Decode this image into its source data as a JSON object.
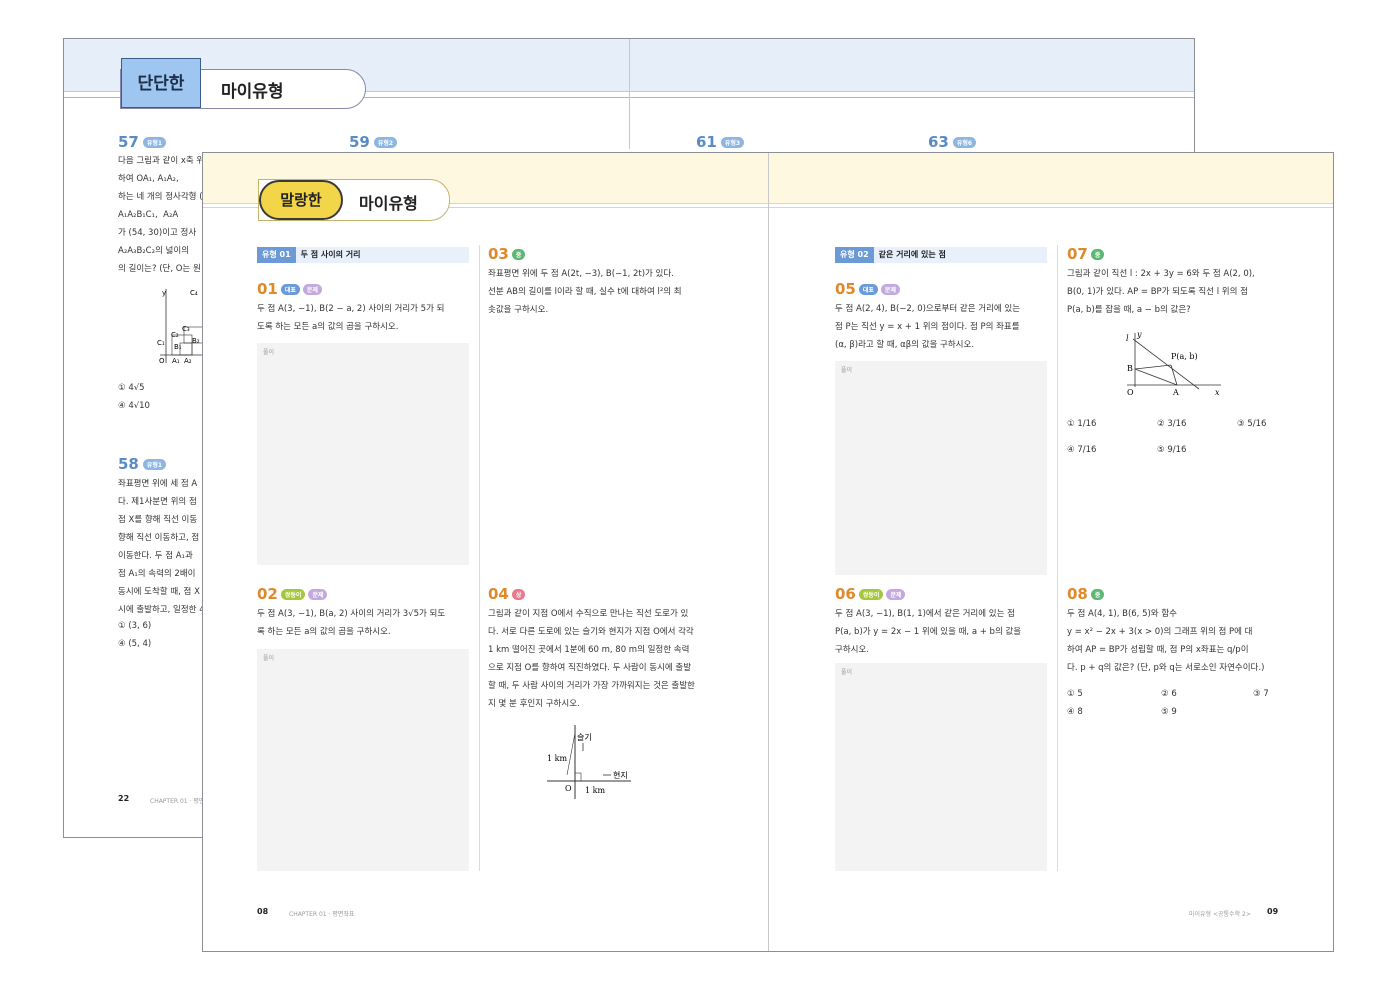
{
  "back_page": {
    "badge_left": "단단한",
    "badge_right": "마이유형",
    "questions": [
      {
        "num": "57",
        "tag": "유형1"
      },
      {
        "num": "59",
        "tag": "유형2"
      },
      {
        "num": "61",
        "tag": "유형3"
      },
      {
        "num": "63",
        "tag": "유형6"
      },
      {
        "num": "58",
        "tag": "유형1"
      }
    ],
    "q57_text": "다음 그림과 같이 x축 위\n하여 OA₁, A₁A₂, \n하는 네 개의 정사각형 (\nA₁A₂B₁C₁,  A₂A\n가 (54, 30)이고 정사\nA₂A₃B₂C₂의 넓이의\n의 길이는? (단, O는 원",
    "q57_choice1": "① 4√5",
    "q57_choice2": "④ 4√10",
    "q58_text": "좌표평면 위에 세 점 A\n다. 제1사분면 위의 점\n점 X를 향해 직선 이동\n향해 직선 이동하고, 점\n이동한다. 두 점 A₁과\n점 A₁의 속력의 2배이\n동시에 도착할 때, 점 X\n시에 출발하고, 일정한 4",
    "q58_choice1": "① (3, 6)",
    "q58_choice2": "④ (5, 4)",
    "fig_labels": {
      "y": "y",
      "c4": "C₄",
      "c3": "C₃",
      "c2": "C₂",
      "c1": "C₁",
      "b1": "B₁",
      "b2": "B₂",
      "o": "O",
      "a1": "A₁",
      "a2": "A₂"
    },
    "page_num": "22",
    "chapter": "CHAPTER 01 · 평면"
  },
  "front_left": {
    "badge_left": "말랑한",
    "badge_right": "마이유형",
    "type_label": "유형 01",
    "type_title": "두 점 사이의 거리",
    "q01": {
      "num": "01",
      "tag1": "대표",
      "tag2": "문제",
      "text": "두 점 A(3, −1), B(2 − a, 2) 사이의 거리가 5가 되\n도록 하는 모든 a의 값의 곱을 구하시오."
    },
    "q02": {
      "num": "02",
      "tag1": "쌍둥이",
      "tag2": "문제",
      "text": "두 점 A(3, −1), B(a, 2) 사이의 거리가 3√5가 되도\n록 하는 모든 a의 값의 곱을 구하시오."
    },
    "q03": {
      "num": "03",
      "tag1": "중",
      "text": "좌표평면 위에 두 점 A(2t, −3), B(−1, 2t)가 있다.\n선분 AB의 길이를 l이라 할 때, 실수 t에 대하여 l²의 최\n솟값을 구하시오."
    },
    "q04": {
      "num": "04",
      "tag1": "상",
      "text": "그림과 같이 지점 O에서 수직으로 만나는 직선 도로가 있\n다. 서로 다른 도로에 있는 슬기와 현지가 지점 O에서 각각\n1 km 떨어진 곳에서 1분에 60 m, 80 m의 일정한 속력\n으로 지점 O를 향하여 직진하였다. 두 사람이 동시에 출발\n할 때, 두 사람 사이의 거리가 가장 가까워지는 것은 출발한\n지 몇 분 후인지 구하시오."
    },
    "fig04": {
      "seulgi": "슬기",
      "hyunji": "현지",
      "km_v": "1 km",
      "km_h": "1 km",
      "o": "O"
    },
    "solve_label": "풀이",
    "page_num": "08",
    "chapter": "CHAPTER 01 · 평면좌표"
  },
  "front_right": {
    "type_label": "유형 02",
    "type_title": "같은 거리에 있는 점",
    "q05": {
      "num": "05",
      "tag1": "대표",
      "tag2": "문제",
      "text": "두 점 A(2, 4), B(−2, 0)으로부터 같은 거리에 있는\n점 P는 직선 y = x + 1 위의 점이다. 점 P의 좌표를\n(α, β)라고 할 때, αβ의 값을 구하시오."
    },
    "q06": {
      "num": "06",
      "tag1": "쌍둥이",
      "tag2": "문제",
      "text": "두 점 A(3, −1), B(1, 1)에서 같은 거리에 있는 점\nP(a, b)가 y = 2x − 1 위에 있을 때, a + b의 값을\n구하시오."
    },
    "q07": {
      "num": "07",
      "tag1": "중",
      "text": "그림과 같이 직선 l : 2x + 3y = 6와 두 점 A(2, 0),\nB(0, 1)가 있다. AP = BP가 되도록 직선 l 위의 점\nP(a, b)를 잡을 때, a − b의 값은?"
    },
    "q07_choices": [
      "① 1/16",
      "② 3/16",
      "③ 5/16",
      "④ 7/16",
      "⑤ 9/16"
    ],
    "fig07": {
      "l": "l",
      "y": "y",
      "p": "P(a, b)",
      "b": "B",
      "o": "O",
      "a": "A",
      "x": "x"
    },
    "q08": {
      "num": "08",
      "tag1": "중",
      "text": "두 점 A(4, 1), B(6, 5)와 함수\ny = x² − 2x + 3(x > 0)의 그래프 위의 점 P에 대\n하여 AP = BP가 성립할 때, 점 P의 x좌표는 q/p이\n다. p + q의 값은? (단, p와 q는 서로소인 자연수이다.)"
    },
    "q08_choices": [
      "① 5",
      "② 6",
      "③ 7",
      "④ 8",
      "⑤ 9"
    ],
    "solve_label": "풀이",
    "page_num": "09",
    "footer": "마이유형 <공통수학 2>"
  }
}
